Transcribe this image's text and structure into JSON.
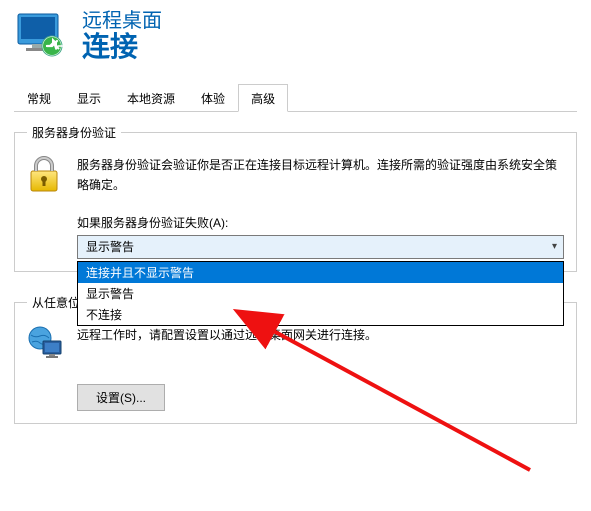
{
  "header": {
    "title": "远程桌面",
    "subtitle": "连接"
  },
  "tabs": {
    "items": [
      {
        "label": "常规"
      },
      {
        "label": "显示"
      },
      {
        "label": "本地资源"
      },
      {
        "label": "体验"
      },
      {
        "label": "高级"
      }
    ],
    "activeIndex": 4
  },
  "auth_group": {
    "legend": "服务器身份验证",
    "description": "服务器身份验证会验证你是否正在连接目标远程计算机。连接所需的验证强度由系统安全策略确定。",
    "fail_label": "如果服务器身份验证失败(A):",
    "selected": "显示警告",
    "options": [
      "连接并且不显示警告",
      "显示警告",
      "不连接"
    ],
    "highlightedIndex": 0
  },
  "gateway_group": {
    "legend": "从任意位置",
    "legend_visible_fragment": "从任意位置",
    "description": "远程工作时，请配置设置以通过远程桌面网关进行连接。",
    "settings_button": "设置(S)..."
  },
  "icons": {
    "app": "rdp-monitor",
    "lock": "lock-icon",
    "globe_monitor": "globe-monitor-icon"
  }
}
